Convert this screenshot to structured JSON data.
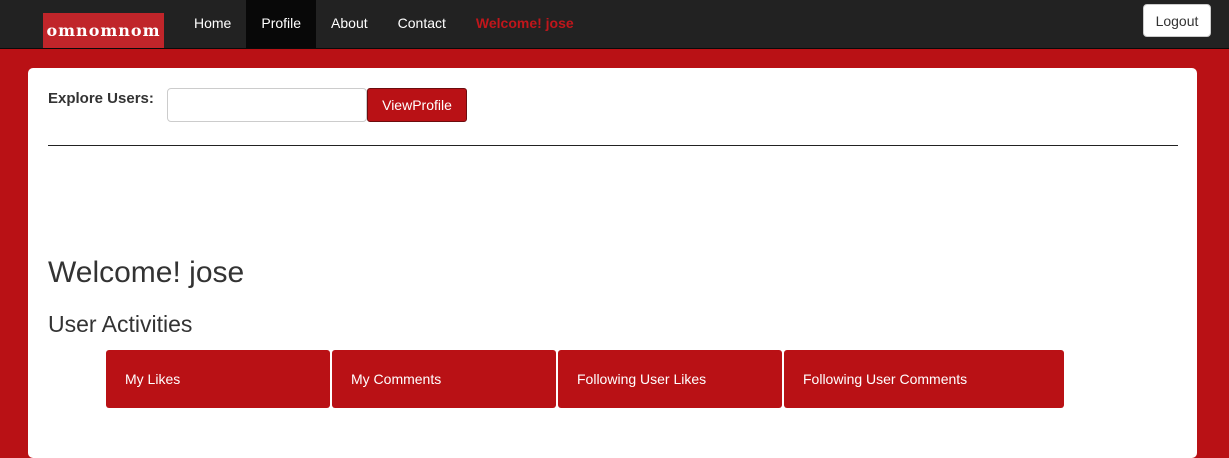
{
  "navbar": {
    "brand": "omnomnom",
    "items": [
      {
        "label": "Home",
        "active": false
      },
      {
        "label": "Profile",
        "active": true
      },
      {
        "label": "About",
        "active": false
      },
      {
        "label": "Contact",
        "active": false
      }
    ],
    "welcome": "Welcome! jose",
    "logout_label": "Logout"
  },
  "explore": {
    "label": "Explore Users:",
    "input_value": "",
    "button_label": "ViewProfile"
  },
  "main": {
    "welcome_heading": "Welcome! jose",
    "activities_heading": "User Activities",
    "tabs": [
      {
        "label": "My Likes"
      },
      {
        "label": "My Comments"
      },
      {
        "label": "Following User Likes"
      },
      {
        "label": "Following User Comments"
      }
    ]
  },
  "colors": {
    "accent": "#b91115",
    "navbar": "#222222",
    "active_nav": "#080808",
    "welcome_text": "#c0161b"
  }
}
